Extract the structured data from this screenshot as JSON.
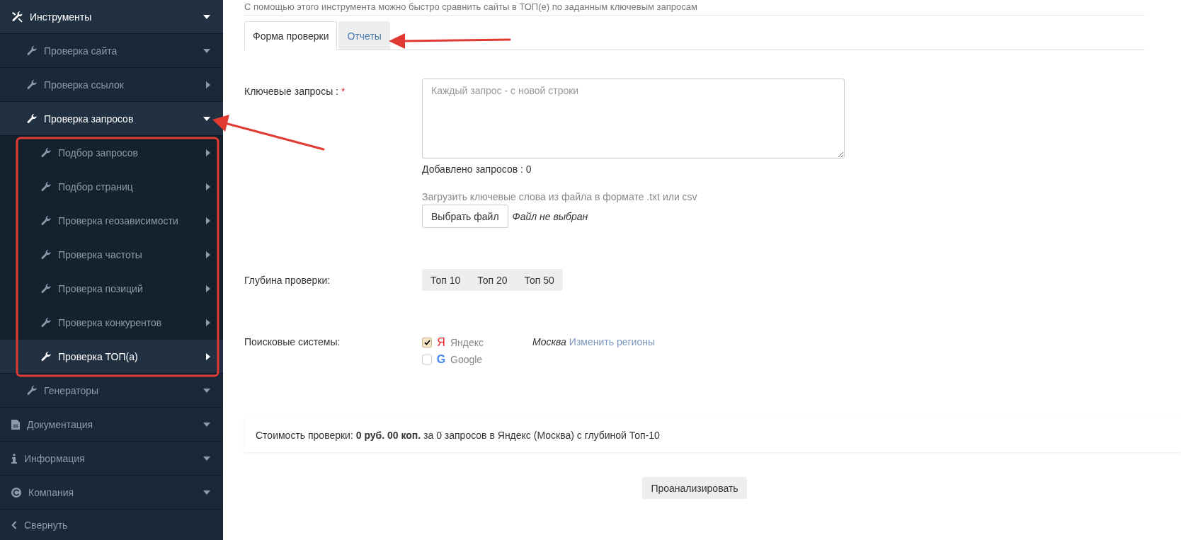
{
  "sidebar": {
    "items": [
      {
        "label": "Инструменты",
        "kind": "tools",
        "active": true,
        "expanded": true,
        "children": [
          {
            "label": "Проверка сайта",
            "kind": "wrench",
            "active": false,
            "expanded": true
          },
          {
            "label": "Проверка ссылок",
            "kind": "wrench",
            "active": false,
            "expanded": false
          },
          {
            "label": "Проверка запросов",
            "kind": "wrench",
            "active": true,
            "expanded": true,
            "children": [
              {
                "label": "Подбор запросов",
                "kind": "wrench",
                "active": false,
                "expanded": false
              },
              {
                "label": "Подбор страниц",
                "kind": "wrench",
                "active": false,
                "expanded": false
              },
              {
                "label": "Проверка геозависимости",
                "kind": "wrench",
                "active": false,
                "expanded": false
              },
              {
                "label": "Проверка частоты",
                "kind": "wrench",
                "active": false,
                "expanded": false
              },
              {
                "label": "Проверка позиций",
                "kind": "wrench",
                "active": false,
                "expanded": false
              },
              {
                "label": "Проверка конкурентов",
                "kind": "wrench",
                "active": false,
                "expanded": false
              },
              {
                "label": "Проверка ТОП(а)",
                "kind": "wrench",
                "active": true,
                "expanded": false
              }
            ]
          },
          {
            "label": "Генераторы",
            "kind": "wrench",
            "active": false,
            "expanded": true
          }
        ]
      },
      {
        "label": "Документация",
        "kind": "document",
        "active": false,
        "expanded": true
      },
      {
        "label": "Информация",
        "kind": "info",
        "active": false,
        "expanded": true
      },
      {
        "label": "Компания",
        "kind": "copyright",
        "active": false,
        "expanded": true
      },
      {
        "label": "Свернуть",
        "kind": "collapse",
        "active": false
      }
    ]
  },
  "intro": "С помощью этого инструмента можно быстро сравнить сайты в ТОП(е) по заданным ключевым запросам",
  "tabs": [
    {
      "label": "Форма проверки",
      "selected": true
    },
    {
      "label": "Отчеты",
      "selected": false
    }
  ],
  "form": {
    "keywords": {
      "label": "Ключевые запросы :",
      "required_mark": "*",
      "placeholder": "Каждый запрос - с новой строки",
      "counter": "Добавлено запросов : 0",
      "upload_hint": "Загрузить ключевые слова из файла в формате .txt или csv",
      "file_button": "Выбрать файл",
      "file_status": "Файл не выбран"
    },
    "depth": {
      "label": "Глубина проверки:",
      "options": [
        "Топ 10",
        "Топ 20",
        "Топ 50"
      ]
    },
    "engines": {
      "label": "Поисковые системы:",
      "items": [
        {
          "kind": "yandex",
          "logo": "Я",
          "name": "Яндекс",
          "checked": true
        },
        {
          "kind": "google",
          "logo": "G",
          "name": "Google",
          "checked": false
        }
      ],
      "region": "Москва",
      "region_link": "Изменить регионы"
    }
  },
  "cost": "Стоимость проверки: **0 руб. 00 коп.** за 0 запросов в Яндекс (Москва) с глубиной Топ-10",
  "submit": "Проанализировать"
}
